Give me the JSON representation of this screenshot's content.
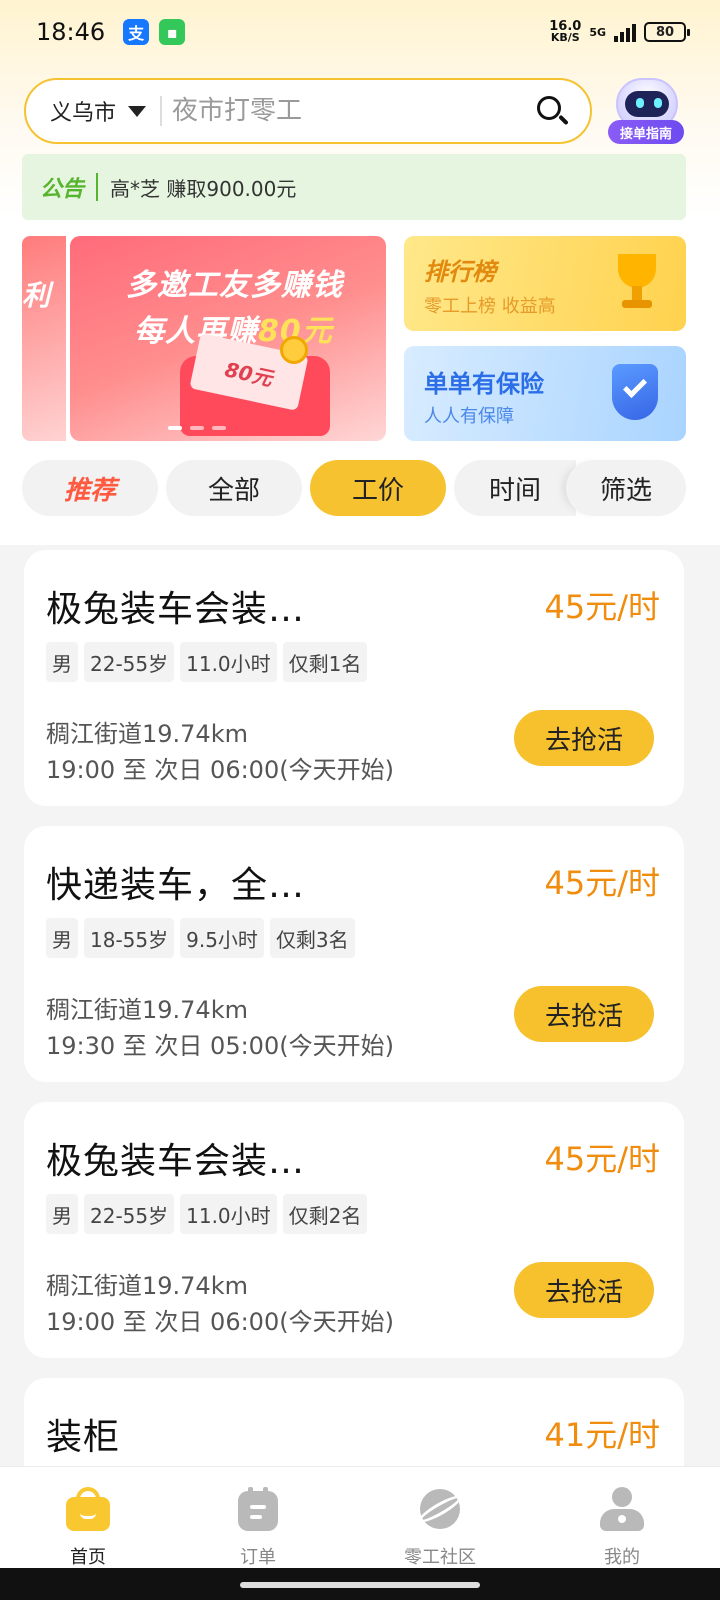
{
  "status_bar": {
    "time": "18:46",
    "net_speed_value": "16.0",
    "net_speed_unit": "KB/S",
    "signal_label": "5G",
    "battery": "80"
  },
  "search": {
    "city": "义乌市",
    "placeholder": "夜市打零工"
  },
  "assistant": {
    "label": "接单指南"
  },
  "notice": {
    "tag": "公告",
    "text": "高*芝 赚取900.00元"
  },
  "banners": {
    "peek_text": "利",
    "main_line1": "多邀工友多赚钱",
    "main_line2_prefix": "每人再赚",
    "main_line2_amount": "80元",
    "ticket_text": "80元",
    "rank_title": "排行榜",
    "rank_sub": "零工上榜 收益高",
    "insurance_title": "单单有保险",
    "insurance_sub": "人人有保障"
  },
  "filters": {
    "recommend": "推荐",
    "all": "全部",
    "price": "工价",
    "time": "时间",
    "filter": "筛选"
  },
  "jobs": [
    {
      "title": "极兔装车会装…",
      "price": "45元/时",
      "tags": [
        "男",
        "22-55岁",
        "11.0小时",
        "仅剩1名"
      ],
      "location": "稠江街道19.74km",
      "time": "19:00 至 次日 06:00(今天开始)",
      "button": "去抢活"
    },
    {
      "title": "快递装车，全…",
      "price": "45元/时",
      "tags": [
        "男",
        "18-55岁",
        "9.5小时",
        "仅剩3名"
      ],
      "location": "稠江街道19.74km",
      "time": "19:30 至 次日 05:00(今天开始)",
      "button": "去抢活"
    },
    {
      "title": "极兔装车会装…",
      "price": "45元/时",
      "tags": [
        "男",
        "22-55岁",
        "11.0小时",
        "仅剩2名"
      ],
      "location": "稠江街道19.74km",
      "time": "19:00 至 次日 06:00(今天开始)",
      "button": "去抢活"
    },
    {
      "title": "装柜",
      "price": "41元/时"
    }
  ],
  "bottom_nav": {
    "home": "首页",
    "orders": "订单",
    "community": "零工社区",
    "me": "我的"
  },
  "colors": {
    "accent_yellow": "#f7c12d",
    "price_orange": "#f08c0e",
    "notice_green": "#57b42e"
  }
}
